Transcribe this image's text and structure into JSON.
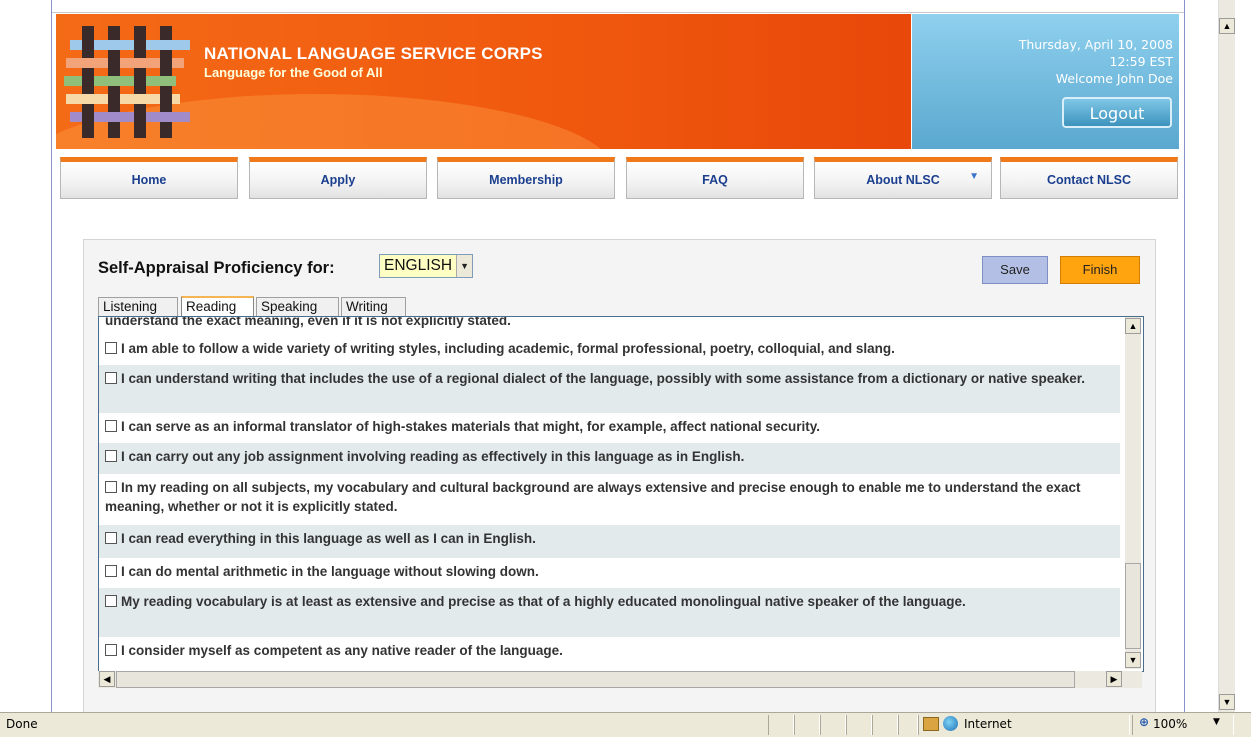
{
  "header": {
    "org_title": "NATIONAL LANGUAGE SERVICE CORPS",
    "tagline": "Language for the Good of All",
    "date": "Thursday, April 10, 2008",
    "time": "12:59 EST",
    "welcome": "Welcome John Doe",
    "logout_label": "Logout"
  },
  "nav": {
    "items": [
      {
        "label": "Home"
      },
      {
        "label": "Apply"
      },
      {
        "label": "Membership"
      },
      {
        "label": "FAQ"
      },
      {
        "label": "About NLSC"
      },
      {
        "label": "Contact NLSC"
      }
    ]
  },
  "form": {
    "title": "Self-Appraisal Proficiency for:",
    "language_selected": "ENGLISH",
    "save_label": "Save",
    "finish_label": "Finish",
    "tabs": [
      "Listening",
      "Reading",
      "Speaking",
      "Writing"
    ],
    "active_tab": "Reading",
    "cut_off_text": "understand the exact meaning, even if it is not explicitly stated.",
    "items": [
      "I am able to follow a wide variety of writing styles, including academic, formal professional, poetry, colloquial, and slang.",
      "I can understand writing that includes the use of a regional dialect of the language, possibly with some assistance from a dictionary or native speaker.",
      "I can serve as an informal translator of high-stakes materials that might, for example, affect national security.",
      "I can carry out any job assignment involving reading as effectively in this language as in English.",
      "In my reading on all subjects, my vocabulary and cultural background are always extensive and precise enough to enable me to understand the exact meaning, whether or not it is explicitly stated.",
      "I can read everything in this language as well as I can in English.",
      "I can do mental arithmetic in the language without slowing down.",
      "My reading vocabulary is at least as extensive and precise as that of a highly educated monolingual native speaker of the language.",
      "I consider myself as competent as any native reader of the language."
    ]
  },
  "statusbar": {
    "status": "Done",
    "zone": "Internet",
    "zoom": "100%"
  },
  "colors": {
    "header_orange": "#f0580e",
    "header_blue": "#5aa8cf",
    "nav_accent": "#f07a1a",
    "nav_text": "#1b3f8f",
    "save_button": "#b3bfe4",
    "finish_button": "#ffa30f",
    "select_bg": "#ffffc4",
    "row_shade": "#e3eaec"
  }
}
